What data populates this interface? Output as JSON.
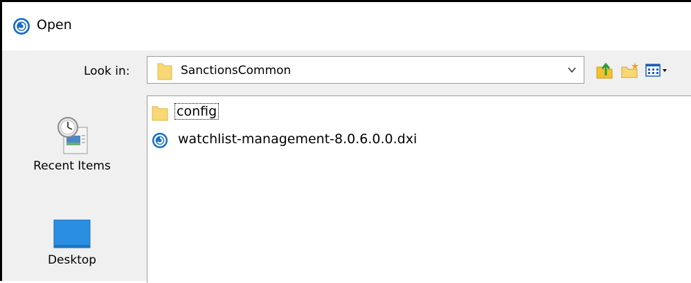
{
  "window": {
    "title": "Open",
    "icon": "app-swirl-icon"
  },
  "lookin": {
    "label": "Look in:",
    "value": "SanctionsCommon",
    "value_icon": "folder-icon"
  },
  "toolbar": {
    "buttons": [
      {
        "name": "up-one-level",
        "icon": "folder-up-arrow-icon"
      },
      {
        "name": "create-new-folder",
        "icon": "new-folder-icon"
      },
      {
        "name": "view-menu",
        "icon": "view-menu-icon"
      }
    ]
  },
  "places": [
    {
      "label": "Recent Items",
      "icon": "recent-items-icon"
    },
    {
      "label": "Desktop",
      "icon": "desktop-icon"
    }
  ],
  "files": [
    {
      "name": "config",
      "type": "folder",
      "icon": "folder-icon",
      "focused": true
    },
    {
      "name": "watchlist-management-8.0.6.0.0.dxi",
      "type": "file",
      "icon": "app-swirl-icon",
      "focused": false
    }
  ],
  "colors": {
    "accent": "#1a6fc2",
    "folder": "#f8d775",
    "desktop": "#2a8fe0"
  }
}
